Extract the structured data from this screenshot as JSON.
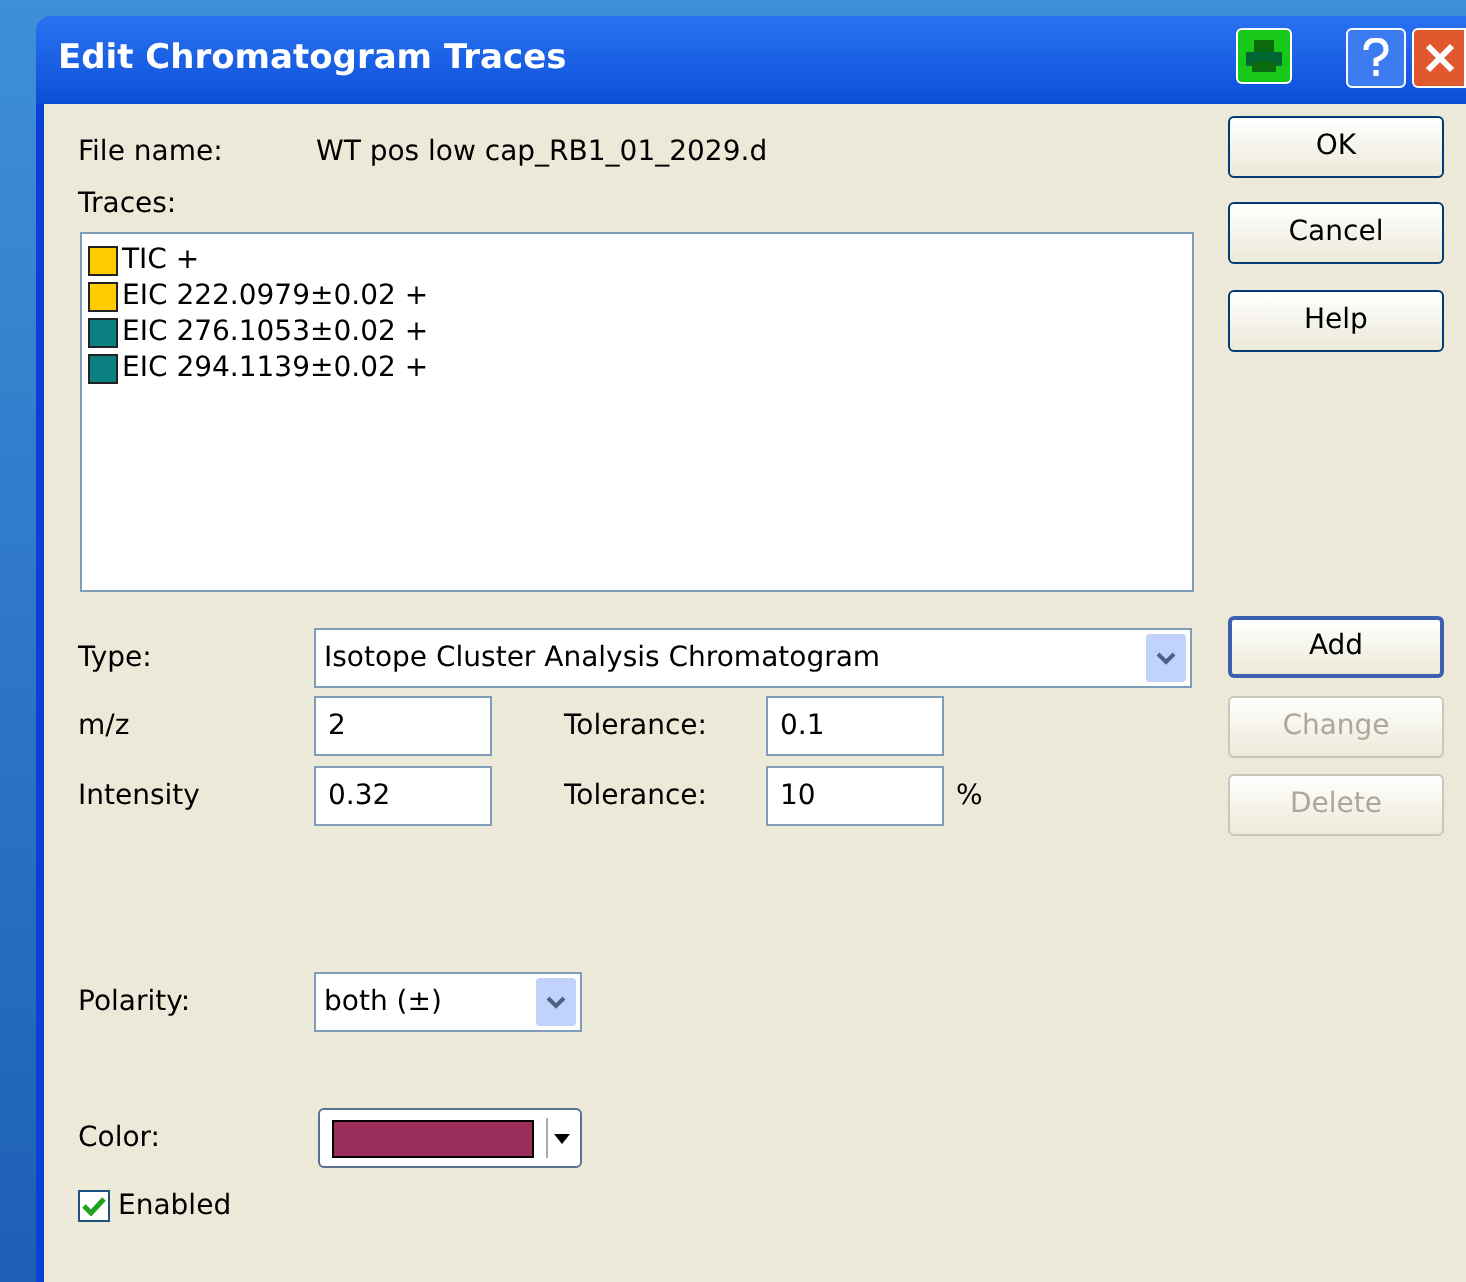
{
  "window": {
    "title": "Edit Chromatogram Traces"
  },
  "file_name": {
    "label": "File name:",
    "value": "WT pos low cap_RB1_01_2029.d"
  },
  "traces": {
    "label": "Traces:",
    "items": [
      {
        "text": "TIC +",
        "color": "#ffcc00"
      },
      {
        "text": "EIC 222.0979±0.02 +",
        "color": "#ffcc00"
      },
      {
        "text": "EIC 276.1053±0.02 +",
        "color": "#0a8080"
      },
      {
        "text": "EIC 294.1139±0.02 +",
        "color": "#0a8080"
      }
    ]
  },
  "type": {
    "label": "Type:",
    "value": "Isotope Cluster Analysis Chromatogram"
  },
  "mz": {
    "label": "m/z",
    "value": "2",
    "tolerance_label": "Tolerance:",
    "tolerance": "0.1"
  },
  "intensity": {
    "label": "Intensity",
    "value": "0.32",
    "tolerance_label": "Tolerance:",
    "tolerance": "10",
    "unit": "%"
  },
  "polarity": {
    "label": "Polarity:",
    "value": "both (±)"
  },
  "color": {
    "label": "Color:",
    "color": "#9b2d5a"
  },
  "enabled": {
    "label": "Enabled",
    "checked": true
  },
  "buttons": [
    {
      "label": "OK",
      "enabled": true,
      "default": false
    },
    {
      "label": "Cancel",
      "enabled": true,
      "default": false
    },
    {
      "label": "Help",
      "enabled": true,
      "default": false
    },
    {
      "label": "Add",
      "enabled": true,
      "default": true
    },
    {
      "label": "Change",
      "enabled": false,
      "default": false
    },
    {
      "label": "Delete",
      "enabled": false,
      "default": false
    }
  ]
}
